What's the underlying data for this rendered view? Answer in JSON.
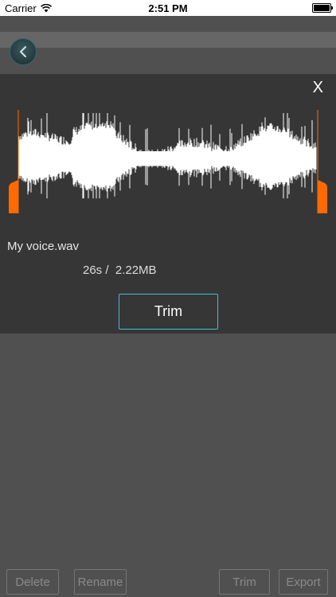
{
  "status_bar": {
    "carrier": "Carrier",
    "time": "2:51 PM"
  },
  "panel": {
    "close_label": "X",
    "file_name": "My voice.wav",
    "file_info": "26s /  2.22MB",
    "trim_label": "Trim"
  },
  "toolbar": {
    "delete_label": "Delete",
    "rename_label": "Rename",
    "trim_label": "Trim",
    "export_label": "Export"
  },
  "colors": {
    "accent": "#3ec3cf",
    "handle": "#ff6a00",
    "panel_bg": "#363636",
    "page_bg": "#505050"
  },
  "icons": [
    "wifi-icon",
    "battery-icon",
    "chevron-left-icon"
  ]
}
